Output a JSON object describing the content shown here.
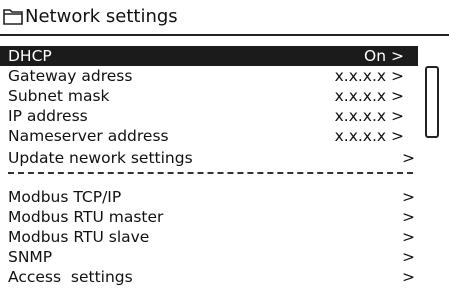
{
  "header": {
    "title": "Network settings",
    "icon": "folder-icon"
  },
  "scroll_list": {
    "items": [
      {
        "label": "DHCP",
        "value": "On >",
        "selected": true
      },
      {
        "label": "Gateway adress",
        "value": "x.x.x.x >"
      },
      {
        "label": "Subnet mask",
        "value": "x.x.x.x >"
      },
      {
        "label": "IP address",
        "value": "x.x.x.x >"
      },
      {
        "label": "Nameserver address",
        "value": "x.x.x.x >"
      }
    ]
  },
  "menu": {
    "update": {
      "label": "Update nework settings",
      "value": ">"
    },
    "items": [
      {
        "label": "Modbus TCP/IP",
        "value": ">"
      },
      {
        "label": "Modbus RTU master",
        "value": ">"
      },
      {
        "label": "Modbus RTU slave",
        "value": ">"
      },
      {
        "label": "SNMP",
        "value": ">"
      },
      {
        "label": "Access  settings",
        "value": ">"
      }
    ]
  },
  "colors": {
    "selection_background": "#1b1b1b",
    "selection_text": "#ffffff",
    "text": "#111111",
    "background": "#ffffff"
  }
}
